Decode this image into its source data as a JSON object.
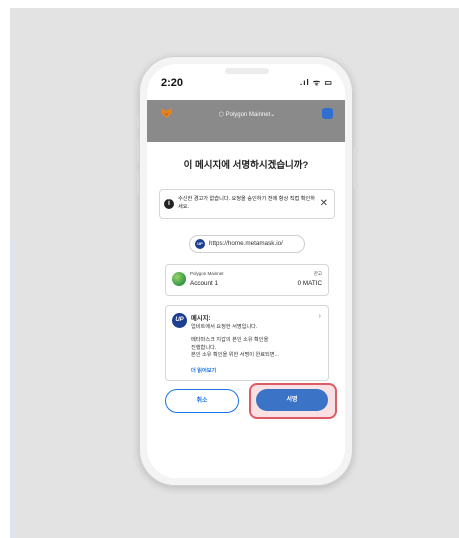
{
  "status_bar": {
    "time": "2:20",
    "signal": ".ıl ᯤ ▭"
  },
  "header": {
    "network": "Polygon Mainnet",
    "network_chevron": "⌄"
  },
  "dialog": {
    "title": "이 메시지에 서명하시겠습니까?",
    "warning": {
      "icon": "info-icon",
      "text": "수신한 경고가 없습니다. 요청을 승인하기 전에 항상 직접 확인하세요.",
      "close": "✕"
    },
    "origin_url": "https://home.metamask.io/",
    "account": {
      "network": "Polygon Mainnet",
      "name": "Account 1",
      "balance_label": "잔고",
      "balance": "0 MATIC"
    },
    "message": {
      "logo": "UP",
      "title": "메시지:",
      "subtitle": "업비트에서 요청한 서명입니다.",
      "body_lines": [
        "메타마스크 지갑의 본인 소유 확인을",
        "진행합니다.",
        "본인 소유 확인을 위한 서명이 완료되면..."
      ],
      "more": "더 읽어보기"
    },
    "buttons": {
      "cancel": "취소",
      "sign": "서명"
    }
  },
  "colors": {
    "accent": "#1a73e8",
    "sign_button": "#3b74c7",
    "highlight": "#e05a66"
  }
}
